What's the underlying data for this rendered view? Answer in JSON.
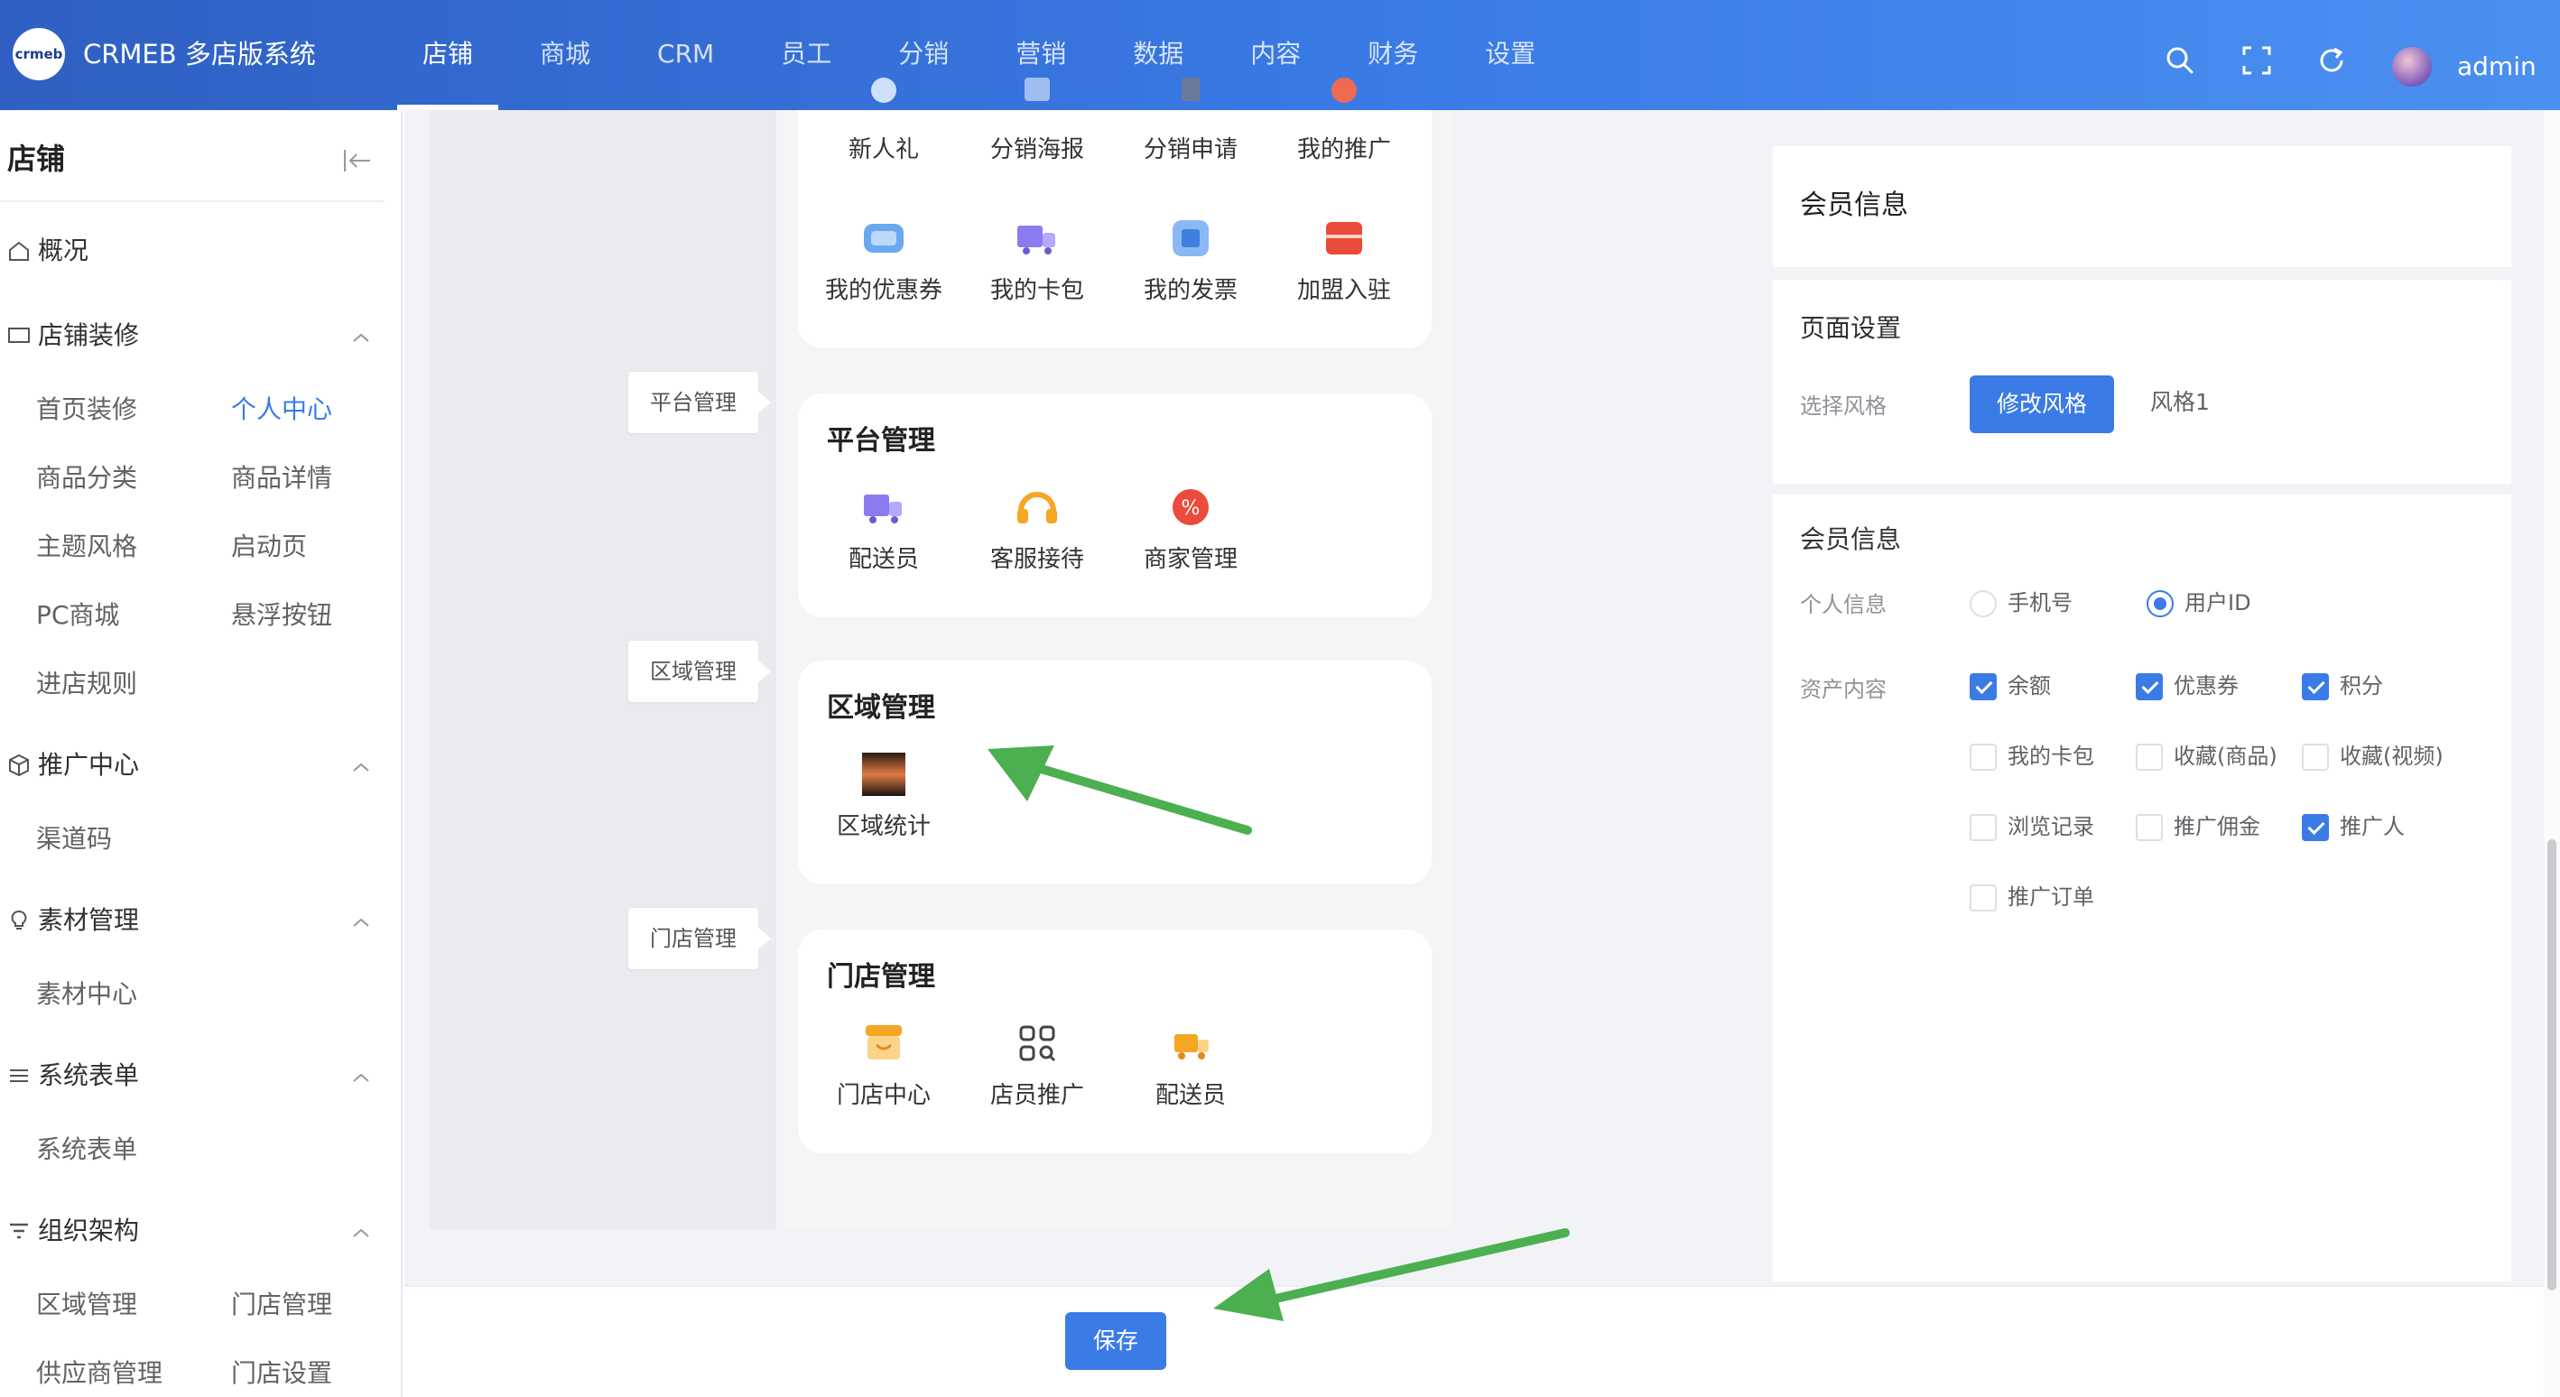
{
  "header": {
    "logo_text": "crmeb",
    "brand": "CRMEB 多店版系统",
    "nav": [
      "店铺",
      "商城",
      "CRM",
      "员工",
      "分销",
      "营销",
      "数据",
      "内容",
      "财务",
      "设置"
    ],
    "active_nav": "店铺",
    "user": "admin",
    "icons": [
      "search-icon",
      "fullscreen-icon",
      "refresh-icon",
      "avatar"
    ]
  },
  "sidebar": {
    "title": "店铺",
    "groups": [
      {
        "label": "概况",
        "icon": "home-icon"
      },
      {
        "label": "店铺装修",
        "icon": "monitor-icon",
        "items": [
          "首页装修",
          "个人中心",
          "商品分类",
          "商品详情",
          "主题风格",
          "启动页",
          "PC商城",
          "悬浮按钮",
          "进店规则"
        ]
      },
      {
        "label": "推广中心",
        "icon": "cube-icon",
        "items": [
          "渠道码"
        ]
      },
      {
        "label": "素材管理",
        "icon": "bulb-icon",
        "items": [
          "素材中心"
        ]
      },
      {
        "label": "系统表单",
        "icon": "list-icon",
        "items": [
          "系统表单"
        ]
      },
      {
        "label": "组织架构",
        "icon": "filter-icon",
        "items": [
          "区域管理",
          "门店管理",
          "供应商管理",
          "门店设置"
        ]
      }
    ],
    "active_item": "个人中心"
  },
  "preview": {
    "top_card": {
      "row1": [
        "新人礼",
        "分销海报",
        "分销申请",
        "我的推广"
      ],
      "row2": [
        "我的优惠券",
        "我的卡包",
        "我的发票",
        "加盟入驻"
      ]
    },
    "sections": [
      {
        "tag": "平台管理",
        "title": "平台管理",
        "items": [
          "配送员",
          "客服接待",
          "商家管理"
        ]
      },
      {
        "tag": "区域管理",
        "title": "区域管理",
        "items": [
          "区域统计"
        ]
      },
      {
        "tag": "门店管理",
        "title": "门店管理",
        "items": [
          "门店中心",
          "店员推广",
          "配送员"
        ]
      }
    ]
  },
  "settings": {
    "header": "会员信息",
    "page_section": {
      "title": "页面设置",
      "style_label": "选择风格",
      "style_button": "修改风格",
      "style_value": "风格1"
    },
    "member_section": {
      "title": "会员信息",
      "personal_label": "个人信息",
      "personal_options": [
        {
          "label": "手机号",
          "selected": false
        },
        {
          "label": "用户ID",
          "selected": true
        }
      ],
      "assets_label": "资产内容",
      "assets": [
        {
          "label": "余额",
          "checked": true
        },
        {
          "label": "优惠券",
          "checked": true
        },
        {
          "label": "积分",
          "checked": true
        },
        {
          "label": "我的卡包",
          "checked": false
        },
        {
          "label": "收藏(商品)",
          "checked": false
        },
        {
          "label": "收藏(视频)",
          "checked": false
        },
        {
          "label": "浏览记录",
          "checked": false
        },
        {
          "label": "推广佣金",
          "checked": false
        },
        {
          "label": "推广人",
          "checked": true
        },
        {
          "label": "推广订单",
          "checked": false
        }
      ]
    }
  },
  "footer": {
    "save": "保存"
  },
  "colors": {
    "primary": "#3a7be6",
    "arrow": "#4caf50"
  }
}
